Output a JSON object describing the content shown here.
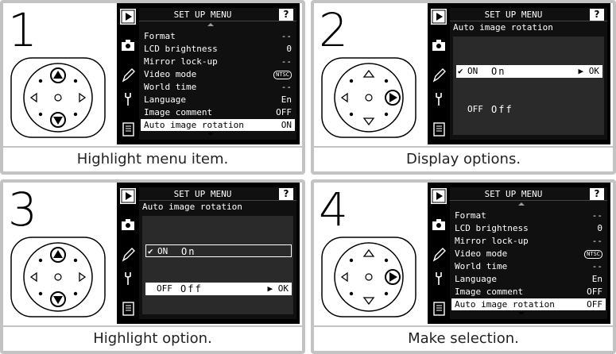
{
  "panels": [
    {
      "step": "1",
      "caption": "Highlight menu item.",
      "screen": {
        "title": "SET UP MENU",
        "help": "?",
        "items": [
          {
            "label": "Format",
            "value": "--"
          },
          {
            "label": "LCD brightness",
            "value": "0"
          },
          {
            "label": "Mirror lock-up",
            "value": "--"
          },
          {
            "label": "Video mode",
            "value": "NTSC"
          },
          {
            "label": "World time",
            "value": "--"
          },
          {
            "label": "Language",
            "value": "En"
          },
          {
            "label": "Image comment",
            "value": "OFF"
          },
          {
            "label": "Auto image rotation",
            "value": "ON"
          }
        ]
      }
    },
    {
      "step": "2",
      "caption": "Display options.",
      "screen": {
        "title": "SET UP MENU",
        "help": "?",
        "subtitle": "Auto image rotation",
        "options": [
          {
            "check": "✔",
            "code": "ON",
            "text": "On",
            "ok": "▶ OK"
          },
          {
            "check": "",
            "code": "OFF",
            "text": "Off",
            "ok": ""
          }
        ]
      }
    },
    {
      "step": "3",
      "caption": "Highlight option.",
      "screen": {
        "title": "SET UP MENU",
        "help": "?",
        "subtitle": "Auto image rotation",
        "options": [
          {
            "check": "✔",
            "code": "ON",
            "text": "On",
            "ok": ""
          },
          {
            "check": "",
            "code": "OFF",
            "text": "Off",
            "ok": "▶ OK"
          }
        ]
      }
    },
    {
      "step": "4",
      "caption": "Make selection.",
      "screen": {
        "title": "SET UP MENU",
        "help": "?",
        "items": [
          {
            "label": "Format",
            "value": "--"
          },
          {
            "label": "LCD brightness",
            "value": "0"
          },
          {
            "label": "Mirror lock-up",
            "value": "--"
          },
          {
            "label": "Video mode",
            "value": "NTSC"
          },
          {
            "label": "World time",
            "value": "--"
          },
          {
            "label": "Language",
            "value": "En"
          },
          {
            "label": "Image comment",
            "value": "OFF"
          },
          {
            "label": "Auto image rotation",
            "value": "OFF"
          }
        ]
      }
    }
  ],
  "icons": [
    "playback-icon",
    "camera-icon",
    "pencil-icon",
    "wrench-icon",
    "recent-settings-icon"
  ],
  "dial_pressed": [
    "up-down",
    "right",
    "up-down",
    "right"
  ],
  "colors": {
    "frame": "#c3c3c3",
    "lcd": "#101010",
    "highlight": "#ffffff"
  }
}
